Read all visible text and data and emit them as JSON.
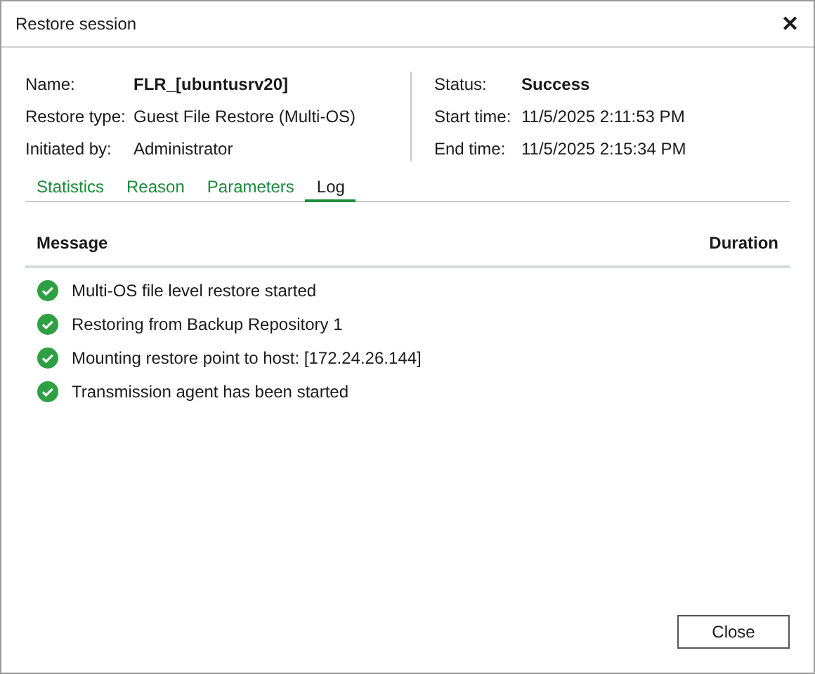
{
  "window": {
    "title": "Restore session",
    "close": "✕"
  },
  "details_left": [
    {
      "label": "Name:",
      "value": "FLR_[ubuntusrv20]",
      "bold": true
    },
    {
      "label": "Restore type:",
      "value": "Guest File Restore (Multi-OS)",
      "bold": false
    },
    {
      "label": "Initiated by:",
      "value": "Administrator",
      "bold": false
    }
  ],
  "details_right": [
    {
      "label": "Status:",
      "value": "Success",
      "bold": true
    },
    {
      "label": "Start time:",
      "value": "11/5/2025 2:11:53 PM",
      "bold": false
    },
    {
      "label": "End time:",
      "value": "11/5/2025 2:15:34 PM",
      "bold": false
    }
  ],
  "tabs": [
    {
      "label": "Statistics",
      "selected": false
    },
    {
      "label": "Reason",
      "selected": false
    },
    {
      "label": "Parameters",
      "selected": false
    },
    {
      "label": "Log",
      "selected": true
    }
  ],
  "table": {
    "columns": [
      "Message",
      "Duration"
    ],
    "rows": [
      {
        "kind": "success",
        "message": "Multi-OS file level restore started"
      },
      {
        "kind": "success",
        "message": "Restoring from Backup Repository 1"
      },
      {
        "kind": "success",
        "message": "Mounting restore point to host: [172.24.26.144]"
      },
      {
        "kind": "success",
        "message": "Transmission agent has been started"
      }
    ]
  },
  "buttons": [
    "Close"
  ]
}
